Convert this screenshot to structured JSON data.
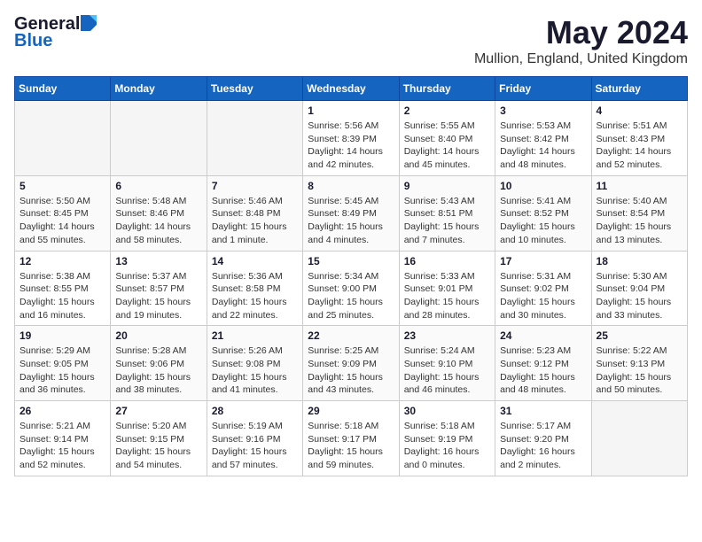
{
  "header": {
    "logo_general": "General",
    "logo_blue": "Blue",
    "title": "May 2024",
    "location": "Mullion, England, United Kingdom"
  },
  "days_of_week": [
    "Sunday",
    "Monday",
    "Tuesday",
    "Wednesday",
    "Thursday",
    "Friday",
    "Saturday"
  ],
  "weeks": [
    {
      "days": [
        {
          "num": "",
          "info": ""
        },
        {
          "num": "",
          "info": ""
        },
        {
          "num": "",
          "info": ""
        },
        {
          "num": "1",
          "info": "Sunrise: 5:56 AM\nSunset: 8:39 PM\nDaylight: 14 hours\nand 42 minutes."
        },
        {
          "num": "2",
          "info": "Sunrise: 5:55 AM\nSunset: 8:40 PM\nDaylight: 14 hours\nand 45 minutes."
        },
        {
          "num": "3",
          "info": "Sunrise: 5:53 AM\nSunset: 8:42 PM\nDaylight: 14 hours\nand 48 minutes."
        },
        {
          "num": "4",
          "info": "Sunrise: 5:51 AM\nSunset: 8:43 PM\nDaylight: 14 hours\nand 52 minutes."
        }
      ]
    },
    {
      "days": [
        {
          "num": "5",
          "info": "Sunrise: 5:50 AM\nSunset: 8:45 PM\nDaylight: 14 hours\nand 55 minutes."
        },
        {
          "num": "6",
          "info": "Sunrise: 5:48 AM\nSunset: 8:46 PM\nDaylight: 14 hours\nand 58 minutes."
        },
        {
          "num": "7",
          "info": "Sunrise: 5:46 AM\nSunset: 8:48 PM\nDaylight: 15 hours\nand 1 minute."
        },
        {
          "num": "8",
          "info": "Sunrise: 5:45 AM\nSunset: 8:49 PM\nDaylight: 15 hours\nand 4 minutes."
        },
        {
          "num": "9",
          "info": "Sunrise: 5:43 AM\nSunset: 8:51 PM\nDaylight: 15 hours\nand 7 minutes."
        },
        {
          "num": "10",
          "info": "Sunrise: 5:41 AM\nSunset: 8:52 PM\nDaylight: 15 hours\nand 10 minutes."
        },
        {
          "num": "11",
          "info": "Sunrise: 5:40 AM\nSunset: 8:54 PM\nDaylight: 15 hours\nand 13 minutes."
        }
      ]
    },
    {
      "days": [
        {
          "num": "12",
          "info": "Sunrise: 5:38 AM\nSunset: 8:55 PM\nDaylight: 15 hours\nand 16 minutes."
        },
        {
          "num": "13",
          "info": "Sunrise: 5:37 AM\nSunset: 8:57 PM\nDaylight: 15 hours\nand 19 minutes."
        },
        {
          "num": "14",
          "info": "Sunrise: 5:36 AM\nSunset: 8:58 PM\nDaylight: 15 hours\nand 22 minutes."
        },
        {
          "num": "15",
          "info": "Sunrise: 5:34 AM\nSunset: 9:00 PM\nDaylight: 15 hours\nand 25 minutes."
        },
        {
          "num": "16",
          "info": "Sunrise: 5:33 AM\nSunset: 9:01 PM\nDaylight: 15 hours\nand 28 minutes."
        },
        {
          "num": "17",
          "info": "Sunrise: 5:31 AM\nSunset: 9:02 PM\nDaylight: 15 hours\nand 30 minutes."
        },
        {
          "num": "18",
          "info": "Sunrise: 5:30 AM\nSunset: 9:04 PM\nDaylight: 15 hours\nand 33 minutes."
        }
      ]
    },
    {
      "days": [
        {
          "num": "19",
          "info": "Sunrise: 5:29 AM\nSunset: 9:05 PM\nDaylight: 15 hours\nand 36 minutes."
        },
        {
          "num": "20",
          "info": "Sunrise: 5:28 AM\nSunset: 9:06 PM\nDaylight: 15 hours\nand 38 minutes."
        },
        {
          "num": "21",
          "info": "Sunrise: 5:26 AM\nSunset: 9:08 PM\nDaylight: 15 hours\nand 41 minutes."
        },
        {
          "num": "22",
          "info": "Sunrise: 5:25 AM\nSunset: 9:09 PM\nDaylight: 15 hours\nand 43 minutes."
        },
        {
          "num": "23",
          "info": "Sunrise: 5:24 AM\nSunset: 9:10 PM\nDaylight: 15 hours\nand 46 minutes."
        },
        {
          "num": "24",
          "info": "Sunrise: 5:23 AM\nSunset: 9:12 PM\nDaylight: 15 hours\nand 48 minutes."
        },
        {
          "num": "25",
          "info": "Sunrise: 5:22 AM\nSunset: 9:13 PM\nDaylight: 15 hours\nand 50 minutes."
        }
      ]
    },
    {
      "days": [
        {
          "num": "26",
          "info": "Sunrise: 5:21 AM\nSunset: 9:14 PM\nDaylight: 15 hours\nand 52 minutes."
        },
        {
          "num": "27",
          "info": "Sunrise: 5:20 AM\nSunset: 9:15 PM\nDaylight: 15 hours\nand 54 minutes."
        },
        {
          "num": "28",
          "info": "Sunrise: 5:19 AM\nSunset: 9:16 PM\nDaylight: 15 hours\nand 57 minutes."
        },
        {
          "num": "29",
          "info": "Sunrise: 5:18 AM\nSunset: 9:17 PM\nDaylight: 15 hours\nand 59 minutes."
        },
        {
          "num": "30",
          "info": "Sunrise: 5:18 AM\nSunset: 9:19 PM\nDaylight: 16 hours\nand 0 minutes."
        },
        {
          "num": "31",
          "info": "Sunrise: 5:17 AM\nSunset: 9:20 PM\nDaylight: 16 hours\nand 2 minutes."
        },
        {
          "num": "",
          "info": ""
        }
      ]
    }
  ]
}
